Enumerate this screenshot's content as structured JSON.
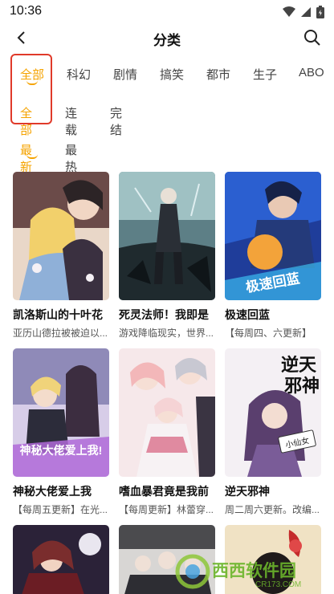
{
  "status_bar": {
    "time": "10:36"
  },
  "header": {
    "title": "分类"
  },
  "genres": [
    {
      "label": "全部",
      "active": true
    },
    {
      "label": "科幻",
      "active": false
    },
    {
      "label": "剧情",
      "active": false
    },
    {
      "label": "搞笑",
      "active": false
    },
    {
      "label": "都市",
      "active": false
    },
    {
      "label": "生子",
      "active": false
    },
    {
      "label": "ABO",
      "active": false
    }
  ],
  "status_filters": [
    {
      "label": "全部",
      "active": true
    },
    {
      "label": "连载",
      "active": false
    },
    {
      "label": "完结",
      "active": false
    }
  ],
  "sort_options": [
    {
      "label": "最新",
      "active": true
    },
    {
      "label": "最热",
      "active": false
    }
  ],
  "comics": [
    {
      "title": "凯洛斯山的十叶花",
      "subtitle": "亚历山德拉被被迫以..."
    },
    {
      "title": "死灵法师！我即是",
      "subtitle": "游戏降临现实，世界..."
    },
    {
      "title": "极速回蓝",
      "subtitle": "【每周四、六更新】"
    },
    {
      "title": "神秘大佬爱上我",
      "subtitle": "【每周五更新】在光..."
    },
    {
      "title": "嗜血暴君竟是我前",
      "subtitle": "【每周更新】林蕾穿..."
    },
    {
      "title": "逆天邪神",
      "subtitle": "周二周六更新。改编..."
    },
    {
      "title": "",
      "subtitle": ""
    },
    {
      "title": "",
      "subtitle": ""
    },
    {
      "title": "",
      "subtitle": ""
    }
  ],
  "cover_texts": {
    "c3": "极速回蓝",
    "c4": "神秘大佬爱上我!",
    "c6a": "逆天",
    "c6b": "邪神",
    "c6c": "小仙女"
  },
  "watermark": {
    "text": "西西软件园",
    "sub": "CR173.COM"
  },
  "colors": {
    "accent": "#f5a300",
    "highlight": "#e03a2a"
  }
}
